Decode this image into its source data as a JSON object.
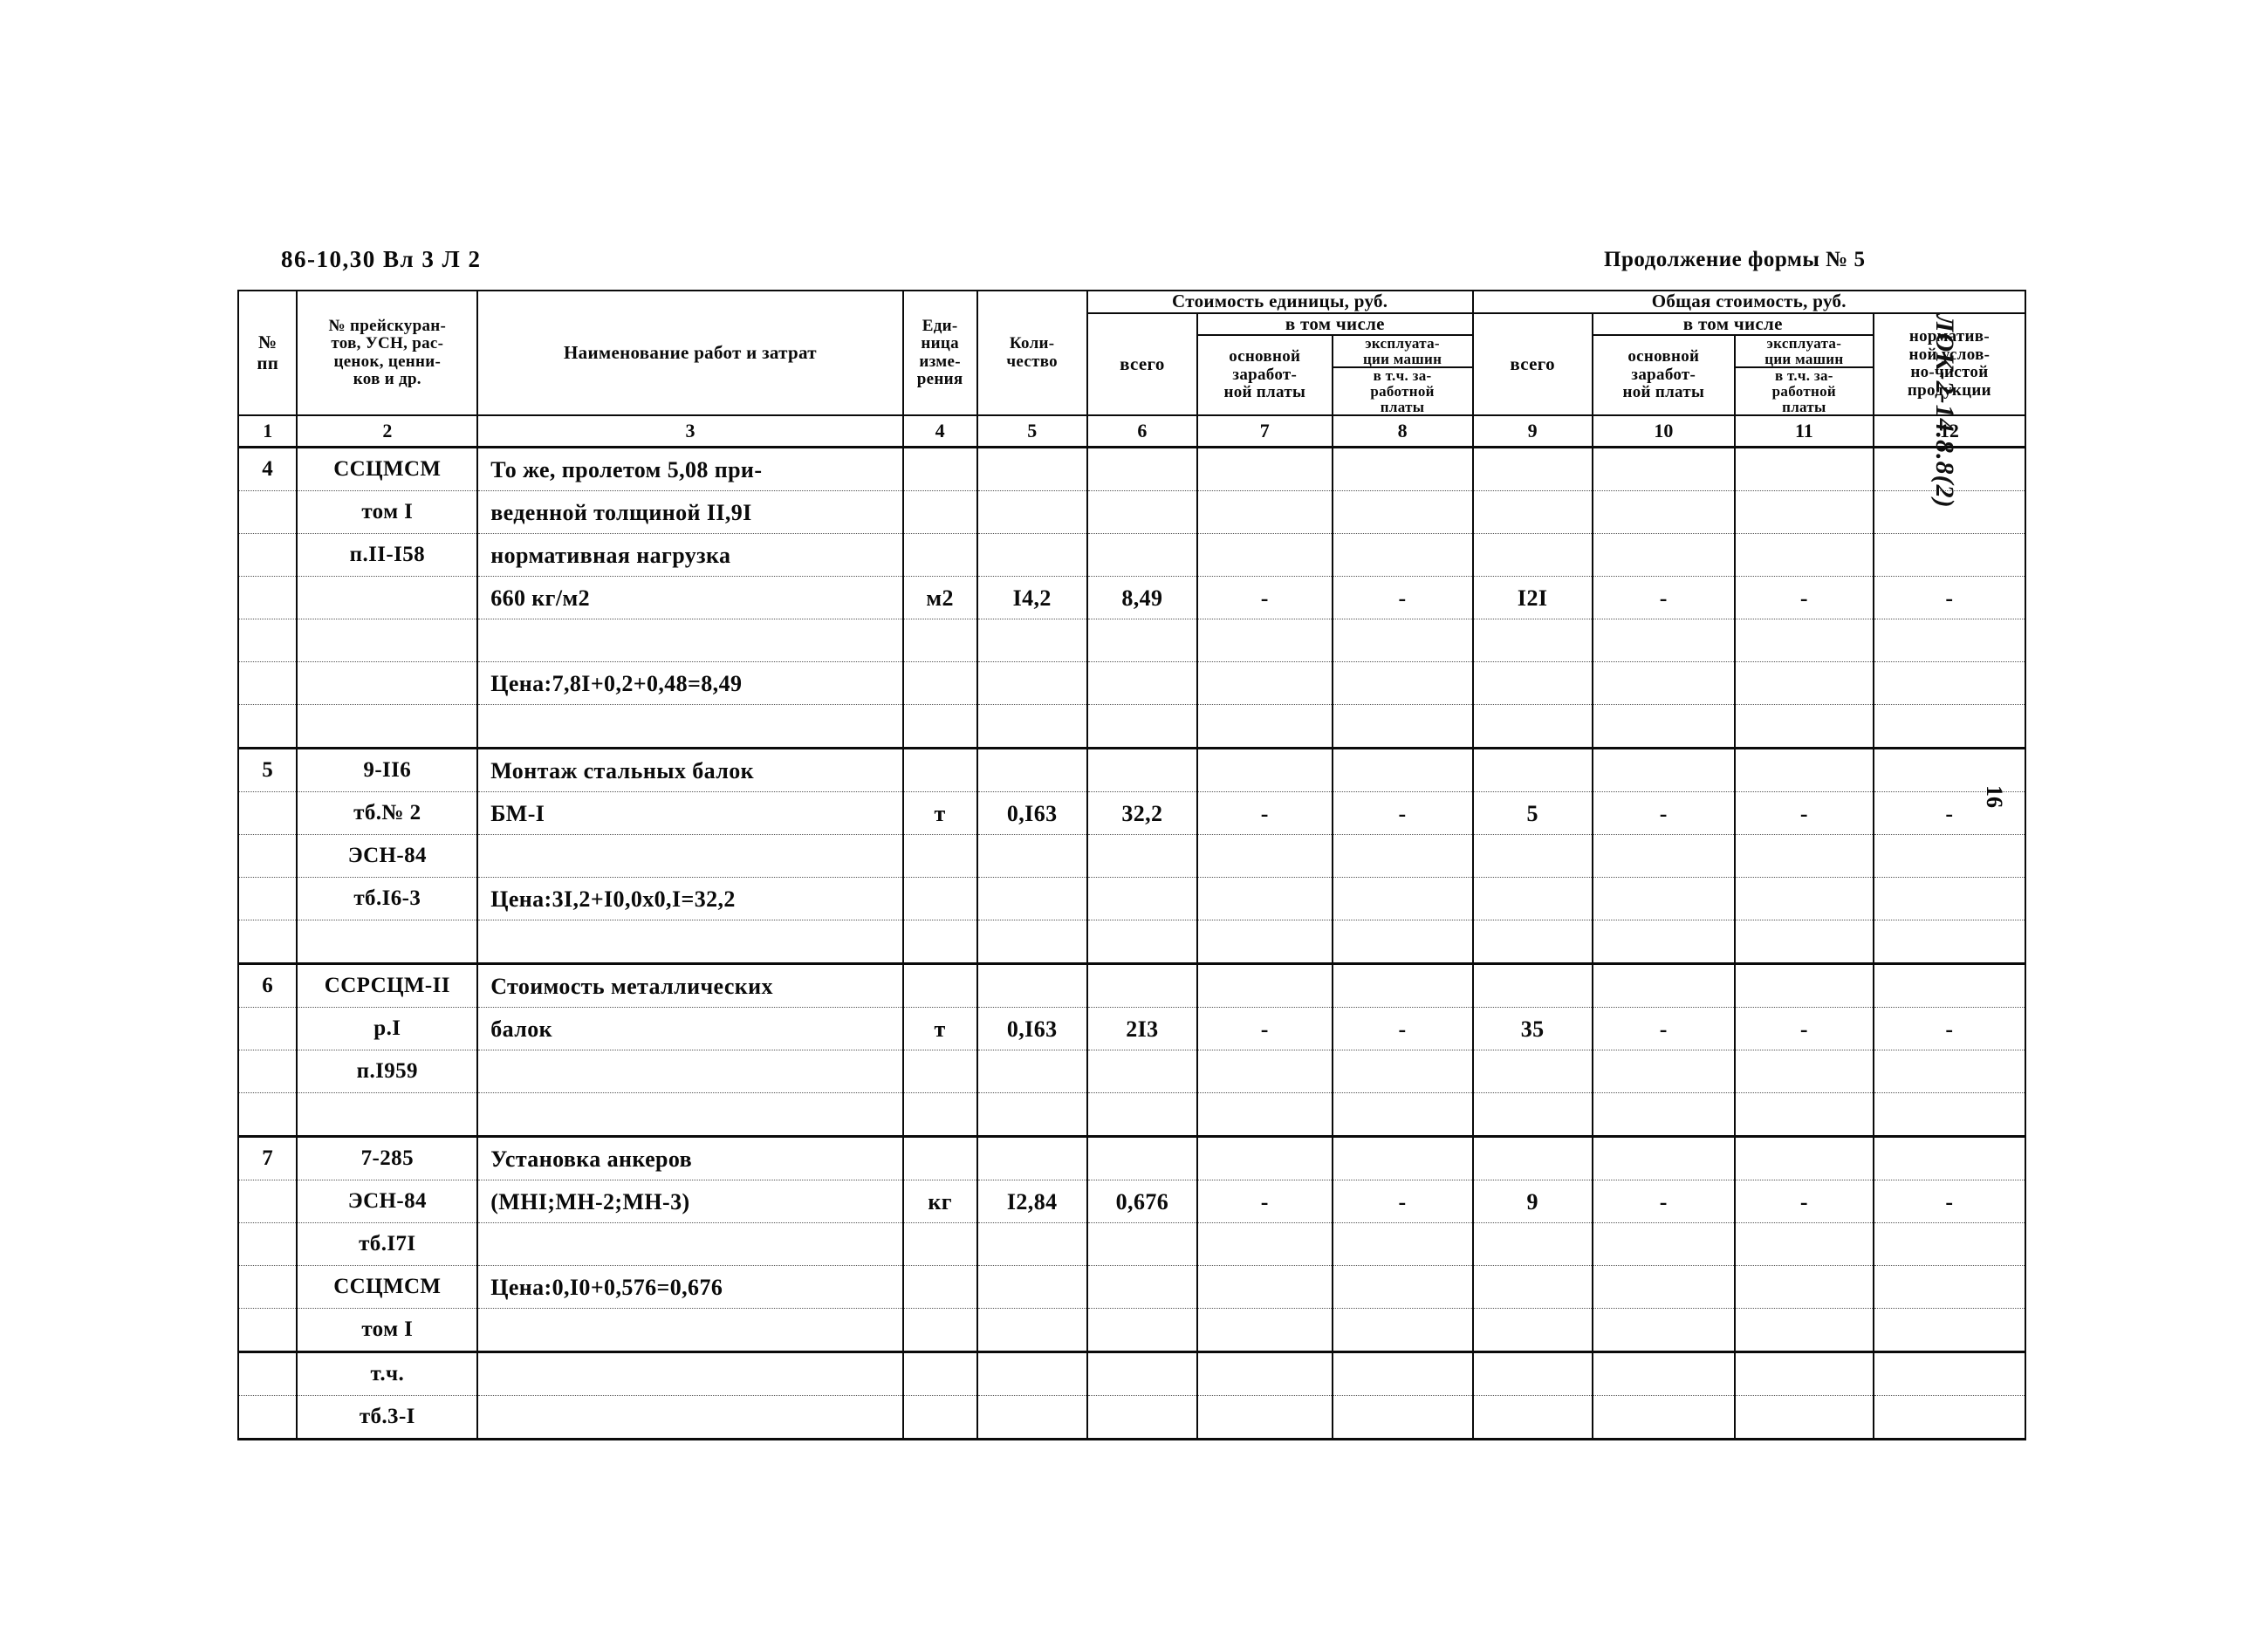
{
  "page": {
    "header_left": "86-10,30  Вл 3 Л 2",
    "header_right": "Продолжение формы № 5",
    "margin_note": "ЛОК-2-14.8.8(2)",
    "page_number": "16"
  },
  "table": {
    "headers": {
      "col1": "№\nпп",
      "col1_l1": "№",
      "col1_l2": "пп",
      "col2_l1": "№ прейскуран-",
      "col2_l2": "тов, УСН, рас-",
      "col2_l3": "ценок, ценни-",
      "col2_l4": "ков и др.",
      "col3": "Наименование работ и затрат",
      "col4_l1": "Еди-",
      "col4_l2": "ница",
      "col4_l3": "измe-",
      "col4_l4": "рения",
      "col5_l1": "Коли-",
      "col5_l2": "чество",
      "group_unit_cost": "Стоимость единицы, руб.",
      "group_total_cost": "Общая стоимость, руб.",
      "vsego": "всего",
      "v_tom_chisle": "в том числе",
      "osnovnoy_l1": "основной",
      "osnovnoy_l2": "заработ-",
      "osnovnoy_l3": "ной платы",
      "ekspl_l1": "эксплуата-",
      "ekspl_l2": "ции машин",
      "ekspl_l3": "в т.ч. за-",
      "ekspl_l4": "работной",
      "ekspl_l5": "платы",
      "norm_l1": "норматив-",
      "norm_l2": "ной услов-",
      "norm_l3": "но-чистой",
      "norm_l4": "продукции"
    },
    "column_numbers": [
      "1",
      "2",
      "3",
      "4",
      "5",
      "6",
      "7",
      "8",
      "9",
      "10",
      "11",
      "12"
    ],
    "rows": [
      {
        "c1": "4",
        "c2": "ССЦМСМ",
        "c3": "То же, пролетом 5,08 при-",
        "c4": "",
        "c5": "",
        "c6": "",
        "c7": "",
        "c8": "",
        "c9": "",
        "c10": "",
        "c11": "",
        "c12": "",
        "group_start": true
      },
      {
        "c1": "",
        "c2": "том I",
        "c3": "веденной толщиной II,9I",
        "c4": "",
        "c5": "",
        "c6": "",
        "c7": "",
        "c8": "",
        "c9": "",
        "c10": "",
        "c11": "",
        "c12": ""
      },
      {
        "c1": "",
        "c2": "п.II-I58",
        "c3": "нормативная нагрузка",
        "c4": "",
        "c5": "",
        "c6": "",
        "c7": "",
        "c8": "",
        "c9": "",
        "c10": "",
        "c11": "",
        "c12": ""
      },
      {
        "c1": "",
        "c2": "",
        "c3": "660 кг/м2",
        "c4": "м2",
        "c5": "I4,2",
        "c6": "8,49",
        "c7": "-",
        "c8": "-",
        "c9": "I2I",
        "c10": "-",
        "c11": "-",
        "c12": "-"
      },
      {
        "c1": "",
        "c2": "",
        "c3": "",
        "c4": "",
        "c5": "",
        "c6": "",
        "c7": "",
        "c8": "",
        "c9": "",
        "c10": "",
        "c11": "",
        "c12": ""
      },
      {
        "c1": "",
        "c2": "",
        "c3": "Цена:7,8I+0,2+0,48=8,49",
        "c4": "",
        "c5": "",
        "c6": "",
        "c7": "",
        "c8": "",
        "c9": "",
        "c10": "",
        "c11": "",
        "c12": ""
      },
      {
        "c1": "",
        "c2": "",
        "c3": "",
        "c4": "",
        "c5": "",
        "c6": "",
        "c7": "",
        "c8": "",
        "c9": "",
        "c10": "",
        "c11": "",
        "c12": "",
        "group_end": true
      },
      {
        "c1": "5",
        "c2": "9-II6",
        "c3": "Монтаж стальных балок",
        "c4": "",
        "c5": "",
        "c6": "",
        "c7": "",
        "c8": "",
        "c9": "",
        "c10": "",
        "c11": "",
        "c12": "",
        "group_start": true
      },
      {
        "c1": "",
        "c2": "тб.№ 2",
        "c3": "БМ-I",
        "c4": "т",
        "c5": "0,I63",
        "c6": "32,2",
        "c7": "-",
        "c8": "-",
        "c9": "5",
        "c10": "-",
        "c11": "-",
        "c12": "-"
      },
      {
        "c1": "",
        "c2": "ЭСН-84",
        "c3": "",
        "c4": "",
        "c5": "",
        "c6": "",
        "c7": "",
        "c8": "",
        "c9": "",
        "c10": "",
        "c11": "",
        "c12": ""
      },
      {
        "c1": "",
        "c2": "тб.I6-3",
        "c3": "Цена:3I,2+I0,0х0,I=32,2",
        "c4": "",
        "c5": "",
        "c6": "",
        "c7": "",
        "c8": "",
        "c9": "",
        "c10": "",
        "c11": "",
        "c12": ""
      },
      {
        "c1": "",
        "c2": "",
        "c3": "",
        "c4": "",
        "c5": "",
        "c6": "",
        "c7": "",
        "c8": "",
        "c9": "",
        "c10": "",
        "c11": "",
        "c12": "",
        "group_end": true
      },
      {
        "c1": "6",
        "c2": "ССРСЦМ-II",
        "c3": "Стоимость металлических",
        "c4": "",
        "c5": "",
        "c6": "",
        "c7": "",
        "c8": "",
        "c9": "",
        "c10": "",
        "c11": "",
        "c12": "",
        "group_start": true
      },
      {
        "c1": "",
        "c2": "р.I",
        "c3": "балок",
        "c4": "т",
        "c5": "0,I63",
        "c6": "2I3",
        "c7": "-",
        "c8": "-",
        "c9": "35",
        "c10": "-",
        "c11": "-",
        "c12": "-"
      },
      {
        "c1": "",
        "c2": "п.I959",
        "c3": "",
        "c4": "",
        "c5": "",
        "c6": "",
        "c7": "",
        "c8": "",
        "c9": "",
        "c10": "",
        "c11": "",
        "c12": ""
      },
      {
        "c1": "",
        "c2": "",
        "c3": "",
        "c4": "",
        "c5": "",
        "c6": "",
        "c7": "",
        "c8": "",
        "c9": "",
        "c10": "",
        "c11": "",
        "c12": "",
        "group_end": true
      },
      {
        "c1": "7",
        "c2": "7-285",
        "c3": "Установка анкеров",
        "c4": "",
        "c5": "",
        "c6": "",
        "c7": "",
        "c8": "",
        "c9": "",
        "c10": "",
        "c11": "",
        "c12": "",
        "group_start": true
      },
      {
        "c1": "",
        "c2": "ЭСН-84",
        "c3": "(МНI;МН-2;МН-3)",
        "c4": "кг",
        "c5": "I2,84",
        "c6": "0,676",
        "c7": "-",
        "c8": "-",
        "c9": "9",
        "c10": "-",
        "c11": "-",
        "c12": "-"
      },
      {
        "c1": "",
        "c2": "тб.I7I",
        "c3": "",
        "c4": "",
        "c5": "",
        "c6": "",
        "c7": "",
        "c8": "",
        "c9": "",
        "c10": "",
        "c11": "",
        "c12": ""
      },
      {
        "c1": "",
        "c2": "ССЦМСМ",
        "c3": "Цена:0,I0+0,576=0,676",
        "c4": "",
        "c5": "",
        "c6": "",
        "c7": "",
        "c8": "",
        "c9": "",
        "c10": "",
        "c11": "",
        "c12": ""
      },
      {
        "c1": "",
        "c2": "том I",
        "c3": "",
        "c4": "",
        "c5": "",
        "c6": "",
        "c7": "",
        "c8": "",
        "c9": "",
        "c10": "",
        "c11": "",
        "c12": "",
        "group_end": true
      },
      {
        "c1": "",
        "c2": "т.ч.",
        "c3": "",
        "c4": "",
        "c5": "",
        "c6": "",
        "c7": "",
        "c8": "",
        "c9": "",
        "c10": "",
        "c11": "",
        "c12": "",
        "group_start": true
      },
      {
        "c1": "",
        "c2": "тб.3-I",
        "c3": "",
        "c4": "",
        "c5": "",
        "c6": "",
        "c7": "",
        "c8": "",
        "c9": "",
        "c10": "",
        "c11": "",
        "c12": ""
      }
    ]
  }
}
